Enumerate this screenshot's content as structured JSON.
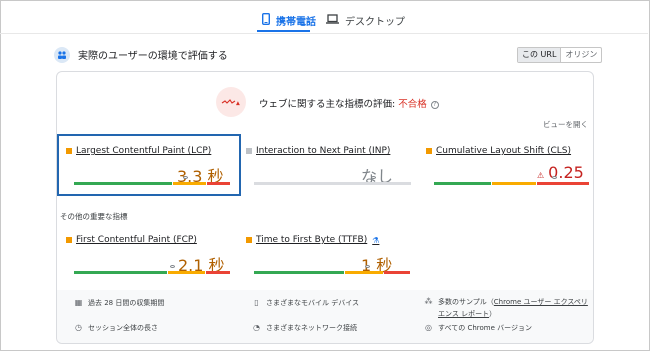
{
  "tabs": [
    {
      "label": "携帯電話",
      "icon": "phone-icon",
      "active": true
    },
    {
      "label": "デスクトップ",
      "icon": "laptop-icon",
      "active": false
    }
  ],
  "section": {
    "title": "実際のユーザーの環境で評価する",
    "url_toggle": {
      "selected": "この URL",
      "other": "オリジン"
    }
  },
  "assessment": {
    "label": "ウェブに関する主な指標の評価: ",
    "result": "不合格",
    "expand_link": "ビューを開く"
  },
  "metrics": {
    "lcp": {
      "name": "Largest Contentful Paint (LCP)",
      "value": "3.3 秒",
      "status": "orange",
      "good": 0.63,
      "ni": 0.22,
      "poor": 0.15,
      "marker": 0.71
    },
    "inp": {
      "name": "Interaction to Next Paint (INP)",
      "value": "なし",
      "status": "gray",
      "marker": 0.76
    },
    "cls": {
      "name": "Cumulative Layout Shift (CLS)",
      "value": "0.25",
      "value_icon": "⚠",
      "status": "red",
      "good": 0.37,
      "ni": 0.29,
      "poor": 0.34,
      "marker": 0.77
    }
  },
  "other_label": "その他の重要な指標",
  "other_metrics": {
    "fcp": {
      "name": "First Contentful Paint (FCP)",
      "value": "2.1 秒",
      "status": "orange",
      "good": 0.6,
      "ni": 0.24,
      "poor": 0.16,
      "marker": 0.63
    },
    "ttfb": {
      "name": "Time to First Byte (TTFB)",
      "value": "1 秒",
      "status": "orange",
      "good": 0.58,
      "ni": 0.25,
      "poor": 0.17,
      "marker": 0.72,
      "beaker_icon": "⚗"
    }
  },
  "footer": {
    "period": "過去 28 日間の収集期間",
    "devices": "さまざまなモバイル デバイス",
    "samples_prefix": "多数のサンプル（",
    "samples_link_1": "Chrome ユーザー エクスペリ",
    "samples_link_2": "エンス レポート",
    "samples_suffix": "）",
    "session": "セッション全体の長さ",
    "network": "さまざまなネットワーク接続",
    "chrome": "すべての Chrome バージョン"
  },
  "colors": {
    "accent": "#1a73e8",
    "fail": "#d93025",
    "good": "#34a853",
    "needs_improvement": "#f9ab00",
    "poor": "#ea4335",
    "highlight": "#2266b0"
  }
}
